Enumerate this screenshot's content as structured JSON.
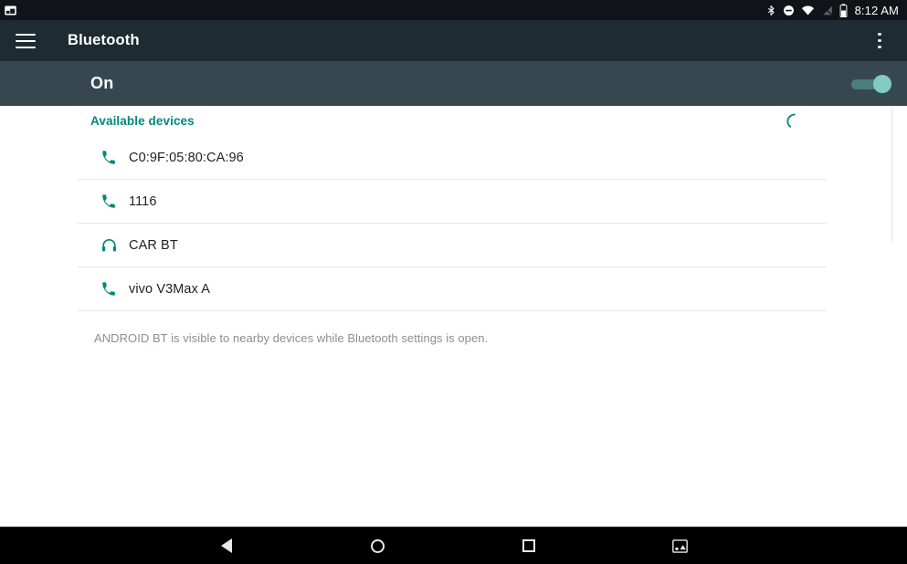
{
  "status_bar": {
    "notification_icon": "screenshot-icon",
    "icons": [
      "bluetooth-icon",
      "do-not-disturb-icon",
      "wifi-icon",
      "cellular-signal-off-icon",
      "battery-icon"
    ],
    "time": "8:12 AM"
  },
  "toolbar": {
    "menu_icon": "hamburger-menu-icon",
    "title": "Bluetooth",
    "overflow_icon": "overflow-menu-icon"
  },
  "bluetooth_switch": {
    "state_label": "On",
    "enabled": true,
    "accent_color": "#80cbc4"
  },
  "section": {
    "title": "Available devices",
    "title_color": "#00897b",
    "scanning": true,
    "spinner_icon": "progress-spinner-icon"
  },
  "devices": [
    {
      "name": "C0:9F:05:80:CA:96",
      "icon": "phone-icon"
    },
    {
      "name": "1116",
      "icon": "phone-icon"
    },
    {
      "name": "CAR BT",
      "icon": "headphones-icon"
    },
    {
      "name": "vivo V3Max A",
      "icon": "phone-icon"
    }
  ],
  "footer": {
    "note": "ANDROID BT is visible to nearby devices while Bluetooth settings is open."
  },
  "nav_bar": {
    "back": "back-icon",
    "home": "home-icon",
    "recents": "recents-icon",
    "screenshot": "screenshot-icon"
  }
}
